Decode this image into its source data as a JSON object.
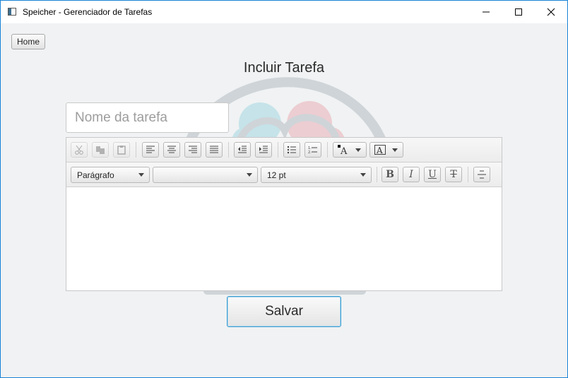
{
  "window": {
    "title": "Speicher - Gerenciador de Tarefas",
    "controls": {
      "minimize": "–",
      "maximize": "☐",
      "close": "✕"
    }
  },
  "nav": {
    "home_label": "Home"
  },
  "page": {
    "title": "Incluir Tarefa"
  },
  "task_name": {
    "placeholder": "Nome da tarefa",
    "value": ""
  },
  "editor": {
    "paragraph_style": "Parágrafo",
    "font_family": "",
    "font_size": "12 pt",
    "body_text": ""
  },
  "actions": {
    "save_label": "Salvar"
  },
  "colors": {
    "accent": "#3c9dd0",
    "window_border": "#1883d7"
  }
}
